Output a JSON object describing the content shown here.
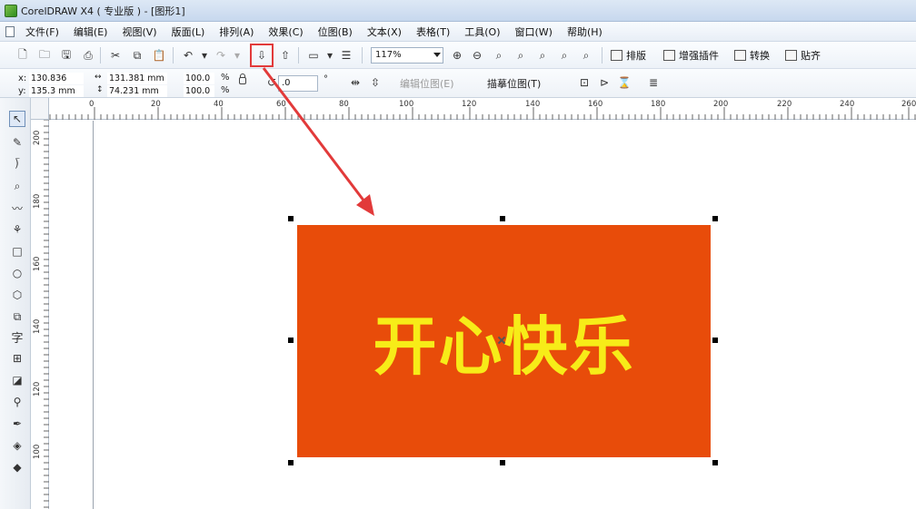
{
  "window": {
    "title": "CorelDRAW X4 ( 专业版 ) - [图形1]"
  },
  "menu": {
    "items": [
      "文件(F)",
      "编辑(E)",
      "视图(V)",
      "版面(L)",
      "排列(A)",
      "效果(C)",
      "位图(B)",
      "文本(X)",
      "表格(T)",
      "工具(O)",
      "窗口(W)",
      "帮助(H)"
    ]
  },
  "toolbar": {
    "zoom_value": "117%",
    "buttons": {
      "layout": "排版",
      "enhance": "增强插件",
      "convert": "转换",
      "paste": "贴齐"
    }
  },
  "property_bar": {
    "x_label": "x:",
    "x_value": "130.836 mm",
    "y_label": "y:",
    "y_value": "135.3 mm",
    "width_value": "131.381 mm",
    "height_value": "74.231 mm",
    "scale_x": "100.0",
    "scale_y": "100.0",
    "percent_symbol": "%",
    "rotation_value": ".0",
    "degree_symbol": "°",
    "edit_bitmap": "编辑位图(E)",
    "trace_bitmap": "描摹位图(T)"
  },
  "ruler": {
    "h_labels": [
      "0",
      "20",
      "40",
      "60",
      "80",
      "100",
      "120",
      "140",
      "160",
      "180",
      "200",
      "220",
      "240",
      "260"
    ],
    "v_labels": [
      "200",
      "180",
      "160",
      "140",
      "120",
      "100"
    ]
  },
  "artwork": {
    "text": "开心快乐",
    "fill_color": "#e84c0a",
    "text_color": "#f7ec18"
  },
  "annotation": {
    "color": "#e23a3a"
  }
}
